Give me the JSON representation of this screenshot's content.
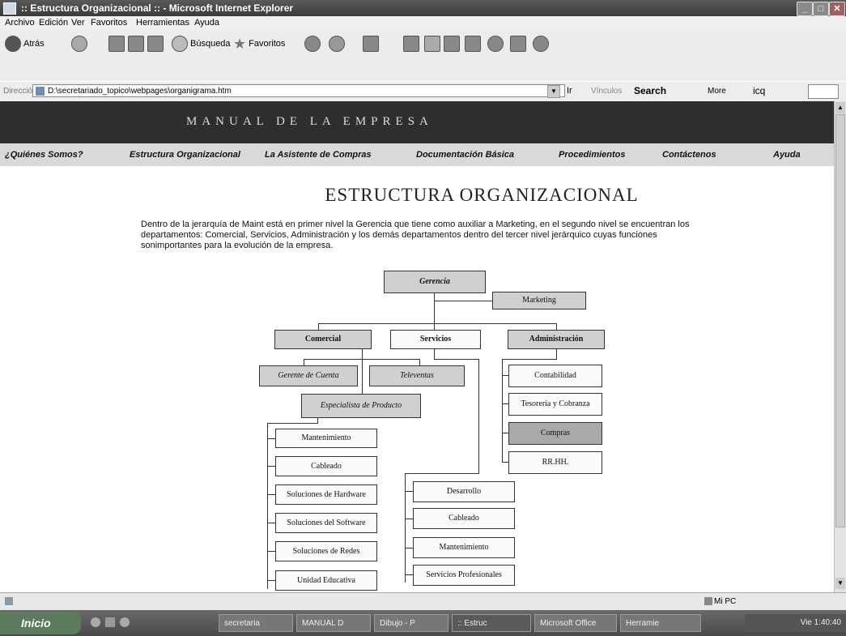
{
  "window": {
    "title": ":: Estructura Organizacional :: - Microsoft Internet Explorer",
    "minimize": "_",
    "maximize": "□",
    "close": "✕"
  },
  "menu": [
    "Archivo",
    "Edición",
    "Ver",
    "Favoritos",
    "Herramientas",
    "Ayuda"
  ],
  "toolbar": {
    "back": "Atrás",
    "search": "Búsqueda",
    "favorites": "Favoritos"
  },
  "addressbar": {
    "label": "Dirección",
    "url": "D:\\secretariado_topico\\webpages\\organigrama.htm",
    "go": "Ir",
    "links": "Vínculos",
    "search": "Search",
    "more": "More",
    "icq": "icq"
  },
  "site": {
    "banner": "MANUAL DE LA EMPRESA",
    "nav": [
      "¿Quiénes Somos?",
      "Estructura Organizacional",
      "La Asistente de Compras",
      "Documentación Básica",
      "Procedimientos",
      "Contáctenos",
      "Ayuda"
    ],
    "heading": "ESTRUCTURA ORGANIZACIONAL",
    "intro": "Dentro de la jerarquía de Maint está en primer nivel la Gerencia que tiene como auxiliar a Marketing, en el segundo nivel se encuentran los departamentos: Comercial, Servicios, Administración y los demás departamentos dentro del tercer nivel jerárquico cuyas funciones sonimportantes para la evolución de la empresa."
  },
  "orgchart": {
    "gerencia": "Gerencia",
    "marketing": "Marketing",
    "comercial": "Comercial",
    "servicios": "Servicios",
    "administracion": "Administración",
    "gerente_cuenta": "Gerente de Cuenta",
    "televentas": "Televentas",
    "especialista": "Especialista de Producto",
    "comercial_items": [
      "Mantenimiento",
      "Cableado",
      "Soluciones de Hardware",
      "Soluciones del Software",
      "Soluciones de Redes",
      "Unidad Educativa"
    ],
    "servicios_items": [
      "Desarrollo",
      "Cableado",
      "Mantenimiento",
      "Servicios Profesionales"
    ],
    "admin_items": [
      "Contabilidad",
      "Tesorería y Cobranza",
      "Compras",
      "RR.HH."
    ]
  },
  "statusbar": {
    "zone": "Mi PC"
  },
  "taskbar": {
    "start": "Inicio",
    "tasks": [
      "secretaria",
      "MANUAL D",
      "Dibujo - P",
      ":: Estruc",
      "Microsoft Office",
      "Herramie"
    ],
    "clock": "Vie 1:40:40"
  }
}
